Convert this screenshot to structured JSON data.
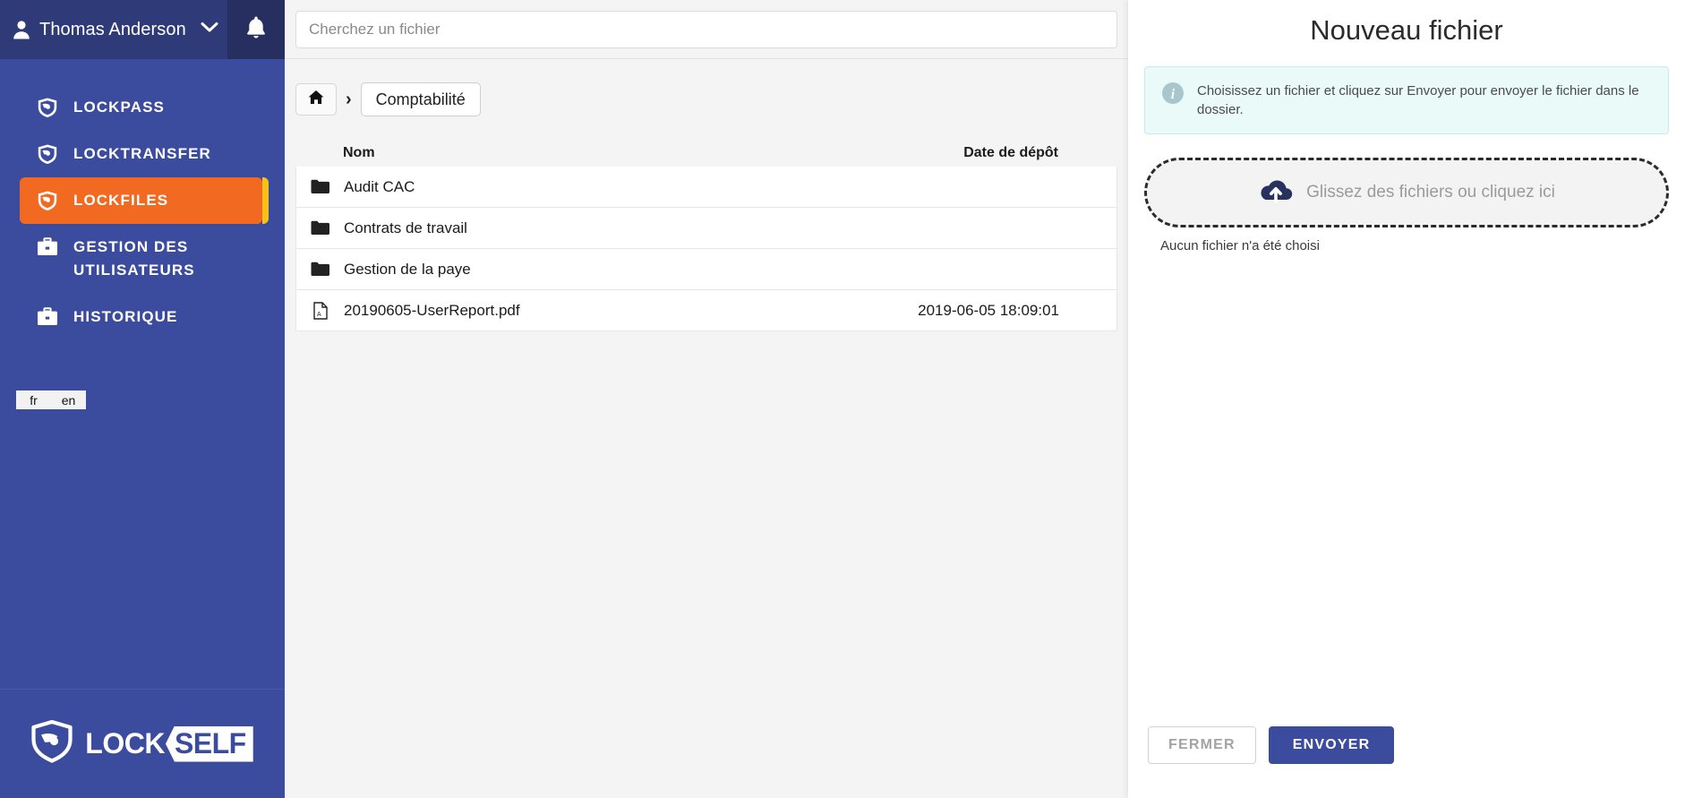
{
  "sidebar": {
    "user": {
      "name": "Thomas Anderson",
      "icon": "user-icon",
      "caret_icon": "chevron-down-icon"
    },
    "notification_icon": "bell-icon",
    "items": [
      {
        "label": "LOCKPASS",
        "icon": "shield-icon",
        "active": false
      },
      {
        "label": "LOCKTRANSFER",
        "icon": "shield-icon",
        "active": false
      },
      {
        "label": "LOCKFILES",
        "icon": "shield-icon",
        "active": true
      },
      {
        "label": "GESTION DES UTILISATEURS",
        "icon": "briefcase-icon",
        "active": false
      },
      {
        "label": "HISTORIQUE",
        "icon": "briefcase-icon",
        "active": false
      }
    ],
    "languages": [
      {
        "code": "fr",
        "selected": true
      },
      {
        "code": "en",
        "selected": false
      }
    ],
    "logo": {
      "mark_icon": "shield-logo-icon",
      "text_primary": "LOCK",
      "text_secondary": "SELF"
    },
    "colors": {
      "background": "#3b4c9e",
      "topbar": "#2f3a78",
      "bell": "#272f61",
      "active": "#f26921",
      "active_edge": "#f6c216"
    }
  },
  "main": {
    "search": {
      "placeholder": "Cherchez un fichier",
      "value": "",
      "icon": "search-input"
    },
    "breadcrumb": {
      "home_icon": "home-icon",
      "separator": "›",
      "items": [
        {
          "label": "Comptabilité"
        }
      ]
    },
    "table": {
      "columns": [
        {
          "key": "name",
          "label": "Nom"
        },
        {
          "key": "date",
          "label": "Date de dépôt"
        }
      ],
      "rows": [
        {
          "icon": "folder-icon",
          "type": "folder",
          "name": "Audit CAC",
          "date": ""
        },
        {
          "icon": "folder-icon",
          "type": "folder",
          "name": "Contrats de travail",
          "date": ""
        },
        {
          "icon": "folder-icon",
          "type": "folder",
          "name": "Gestion de la paye",
          "date": ""
        },
        {
          "icon": "pdf-file-icon",
          "type": "file",
          "name": "20190605-UserReport.pdf",
          "date": "2019-06-05 18:09:01"
        }
      ]
    }
  },
  "panel": {
    "title": "Nouveau fichier",
    "info": {
      "icon": "info-icon",
      "text": "Choisissez un fichier et cliquez sur Envoyer pour envoyer le fichier dans le dossier."
    },
    "dropzone": {
      "icon": "cloud-upload-icon",
      "label": "Glissez des fichiers ou cliquez ici"
    },
    "no_file_text": "Aucun fichier n'a été choisi",
    "actions": {
      "close_label": "FERMER",
      "send_label": "ENVOYER"
    },
    "colors": {
      "info_bg": "#eafaf9",
      "info_border": "#cbe9e7",
      "send_bg": "#3b4c9e"
    }
  }
}
